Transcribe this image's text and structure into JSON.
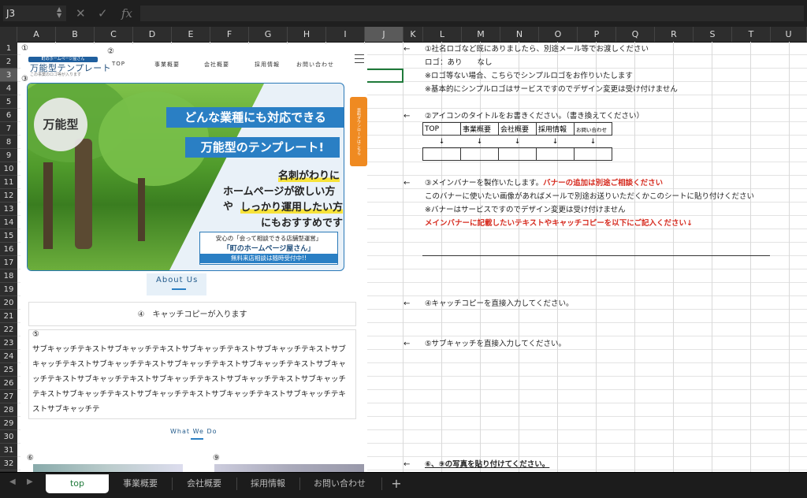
{
  "formula_bar": {
    "cell_ref": "J3",
    "fx": "fx",
    "cancel_icon": "✕",
    "confirm_icon": "✓"
  },
  "columns": [
    "A",
    "B",
    "C",
    "D",
    "E",
    "F",
    "G",
    "H",
    "I",
    "J",
    "K",
    "L",
    "M",
    "N",
    "O",
    "P",
    "Q",
    "R",
    "S",
    "T",
    "U"
  ],
  "selected_column": "J",
  "rows": [
    "1",
    "2",
    "3",
    "4",
    "5",
    "6",
    "7",
    "8",
    "9",
    "10",
    "11",
    "12",
    "13",
    "14",
    "15",
    "16",
    "17",
    "18",
    "19",
    "20",
    "21",
    "22",
    "23",
    "24",
    "25",
    "26",
    "27",
    "28",
    "29",
    "30",
    "31",
    "32"
  ],
  "selected_row": "3",
  "mock": {
    "m1": "①",
    "m2": "②",
    "m3": "③",
    "m4": "④",
    "m5": "⑤",
    "m6": "⑥",
    "m9": "⑨",
    "logo_badge": "町のホームページ屋さん",
    "logo_main": "万能型テンプレート",
    "logo_sub": "この事業のロゴ等が入ります",
    "nav": [
      "TOP",
      "事業概要",
      "会社概要",
      "採用情報",
      "お問い合わせ"
    ],
    "banner_badge": "万能型",
    "banner_line1": "どんな業種にも対応できる",
    "banner_line2": "万能型のテンプレート!",
    "banner_text": [
      "名刺がわりに",
      "ホームページが欲しい方や",
      "しっかり運用したい方",
      "にもおすすめです"
    ],
    "shop_line1": "安心の「会って相談できる店舗型運営」",
    "shop_line2": "「町のホームページ屋さん」",
    "shop_line3": "無料来店相談は随時受付中!!",
    "side_tab": "資料ダウンロードはこちら",
    "about": "About Us",
    "catch": "④　キャッチコピーが入ります",
    "sub_text": "サブキャッチテキストサブキャッチテキストサブキャッチテキストサブキャッチテキストサブキャッチテキストサブキャッチテキストサブキャッチテキストサブキャッチテキストサブキャッチテキストサブキャッチテキストサブキャッチテキストサブキャッチテキストサブキャッチテキストサブキャッチテキストサブキャッチテキストサブキャッチテキストサブキャッチテキストサブキャッチテ",
    "what_we_do": "What We Do"
  },
  "notes": {
    "n1": "①社名ロゴなど既にありましたら、別途メール等でお渡しください",
    "n2": "ロゴ：あり　　なし",
    "n3": "※ロゴ等ない場合、こちらでシンプルロゴをお作りいたします",
    "n4": "※基本的にシンプルロゴはサービスですのでデザイン変更は受け付けません",
    "n6": "②アイコンのタイトルをお書きください。（書き換えてください）",
    "table_headers": [
      "TOP",
      "事業概要",
      "会社概要",
      "採用情報",
      "お問い合わせ"
    ],
    "table_arrows": [
      "↓",
      "↓",
      "↓",
      "↓",
      "↓"
    ],
    "n11a": "③メインバナーを製作いたします。",
    "n11b": "バナーの追加は別途ご相談ください",
    "n12": "このバナーに使いたい画像があればメールで別途お送りいただくかこのシートに貼り付けください",
    "n13": "※バナーはサービスですのでデザイン変更は受け付けません",
    "n14": "メインバナーに記載したいテキストやキャッチコピーを以下にご記入ください↓",
    "n20": "④キャッチコピーを直接入力してください。",
    "n23": "⑤サブキャッチを直接入力してください。",
    "n32": "⑥、⑨の写真を貼り付けてください。",
    "arrow": "←"
  },
  "tabs": [
    "top",
    "事業概要",
    "会社概要",
    "採用情報",
    "お問い合わせ"
  ],
  "active_tab": "top",
  "add_tab": "+",
  "colors": {
    "accent_blue": "#2a7fc4",
    "red_note": "#d62b1f",
    "orange_tab": "#ef8a21",
    "selection_green": "#1f7a3a"
  }
}
